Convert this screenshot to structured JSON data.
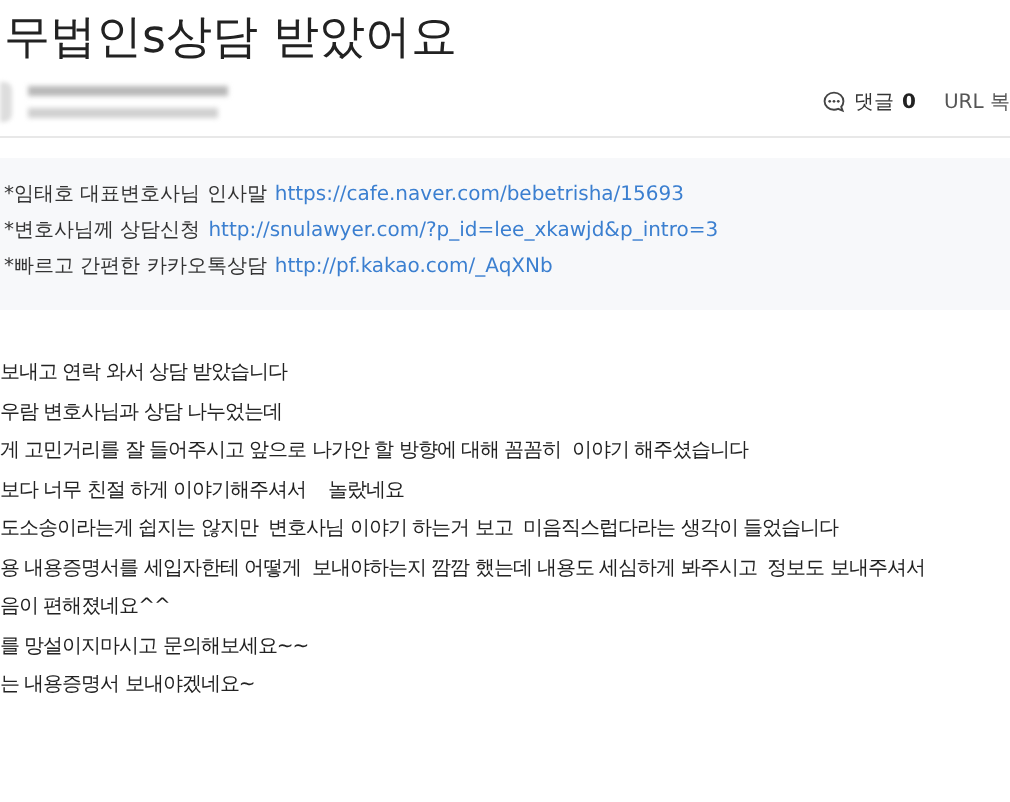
{
  "title": "무법인s상담 받았어요",
  "meta": {
    "comment_label": "댓글",
    "comment_count": "0",
    "url_copy": "URL 복"
  },
  "info_box": [
    {
      "label": "*임태호 대표변호사님 인사말",
      "link": "https://cafe.naver.com/bebetrisha/15693"
    },
    {
      "label": "*변호사님께 상담신청",
      "link": "http://snulawyer.com/?p_id=lee_xkawjd&p_intro=3"
    },
    {
      "label": "*빠르고 간편한 카카오톡상담",
      "link": "http://pf.kakao.com/_AqXNb"
    }
  ],
  "body": [
    "보내고 연락 와서 상담 받았습니다",
    "우람 변호사님과 상담 나누었는데",
    "게 고민거리를 잘 들어주시고 앞으로 나가안 할 방향에 대해 꼼꼼히  이야기 해주셨습니다",
    "보다 너무 친절 하게 이야기해주셔서    놀랐네요",
    "도소송이라는게 쉽지는 않지만  변호사님 이야기 하는거 보고  미음직스럽다라는 생각이 들었습니다",
    "용 내용증명서를 세입자한테 어떻게  보내야하는지 깜깜 했는데 내용도 세심하게 봐주시고  정보도 보내주셔서",
    "음이 편해졌네요^^",
    "를 망설이지마시고 문의해보세요~~",
    "는 내용증명서 보내야겠네요~"
  ]
}
